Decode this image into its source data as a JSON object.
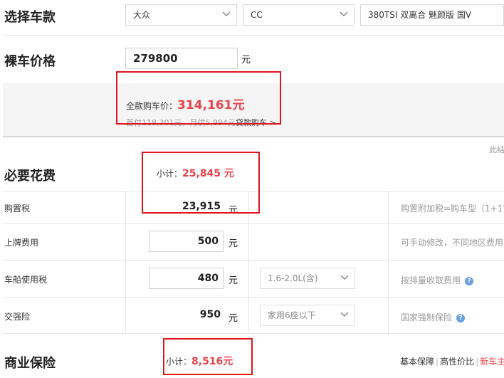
{
  "car_select": {
    "title": "选择车款",
    "brand": "大众",
    "series": "CC",
    "model": "380TSI 双离合 魅颜版 国V"
  },
  "bare_price": {
    "title": "裸车价格",
    "value": "279800",
    "unit": "元"
  },
  "total": {
    "label": "全款购车价：",
    "value": "314,161元",
    "loan_text": "首付118,301元，月供5,994元",
    "loan_link": "贷款购车 >",
    "right_hint": "此结"
  },
  "required_fees": {
    "title": "必要花费",
    "subtotal_label": "小计：",
    "subtotal_value": "25,845 元",
    "rows": [
      {
        "label": "购置税",
        "value": "23,915",
        "unit": "元",
        "note": "购置附加税=购车型（1+17"
      },
      {
        "label": "上牌费用",
        "value": "500",
        "unit": "元",
        "note": "可手动修改，不同地区费用"
      },
      {
        "label": "车船使用税",
        "value": "480",
        "unit": "元",
        "select": "1.6-2.0L(含)",
        "note": "按排量收取费用"
      },
      {
        "label": "交强险",
        "value": "950",
        "unit": "元",
        "select": "家用6座以下",
        "note": "国家强制保险"
      }
    ]
  },
  "commercial_insurance": {
    "title": "商业保险",
    "subtotal_label": "小计：",
    "subtotal_value": "8,516元",
    "links": [
      "基本保障",
      "高性价比",
      "新车主"
    ]
  },
  "colors": {
    "accent_red": "#e8424b",
    "annotation_red": "#e0161f",
    "help_blue": "#6aa0e0"
  }
}
